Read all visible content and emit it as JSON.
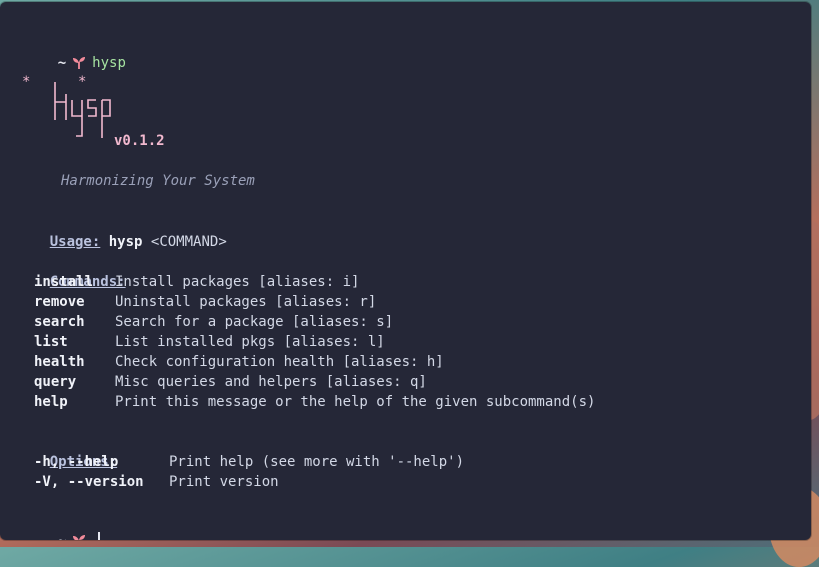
{
  "prompt": {
    "tilde": "~",
    "command": "hysp"
  },
  "logo": {
    "name": "Hysp",
    "version": "v0.1.2",
    "tagline": "Harmonizing Your System"
  },
  "usage": {
    "label": "Usage:",
    "bin": "hysp",
    "arg": "<COMMAND>"
  },
  "commands": {
    "header": "Commands:",
    "items": [
      {
        "name": "install",
        "desc": "Install packages [aliases: i]"
      },
      {
        "name": "remove",
        "desc": "Uninstall packages [aliases: r]"
      },
      {
        "name": "search",
        "desc": "Search for a package [aliases: s]"
      },
      {
        "name": "list",
        "desc": "List installed pkgs [aliases: l]"
      },
      {
        "name": "health",
        "desc": "Check configuration health [aliases: h]"
      },
      {
        "name": "query",
        "desc": "Misc queries and helpers [aliases: q]"
      },
      {
        "name": "help",
        "desc": "Print this message or the help of the given subcommand(s)"
      }
    ]
  },
  "options": {
    "header": "Options:",
    "items": [
      {
        "flag": "-h, --help",
        "desc": "Print help (see more with '--help')"
      },
      {
        "flag": "-V, --version",
        "desc": "Print version"
      }
    ]
  },
  "bottom_prompt": {
    "tilde": "~"
  },
  "colors": {
    "background": "#252737",
    "accent_pink": "#f2b9cf",
    "command_green": "#a6e3a1",
    "text": "#dfe3ee"
  },
  "icons": {
    "prompt_symbol": "sprout-icon"
  }
}
